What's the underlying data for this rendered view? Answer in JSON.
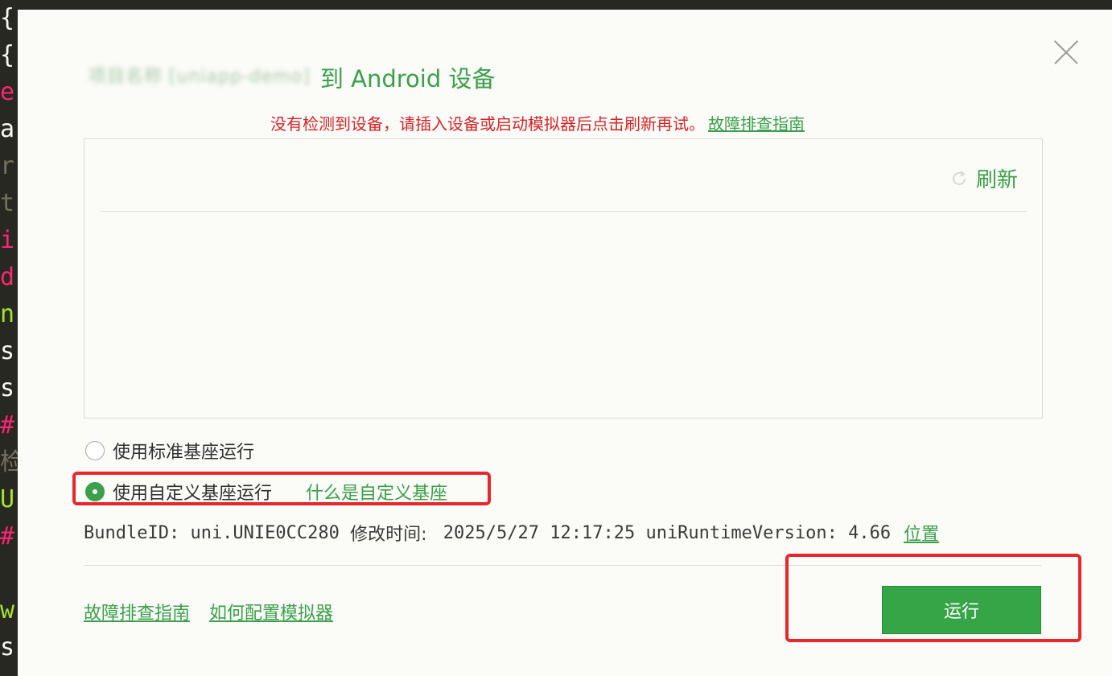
{
  "background_code": {
    "chars": [
      "{",
      "{",
      "e",
      "a",
      "r",
      "t",
      "i",
      "d",
      "n",
      "s",
      "s",
      "#",
      "检",
      "U",
      "#",
      "",
      "w",
      "s"
    ],
    "colors": [
      "#f8f8f2",
      "#f8f8f2",
      "#f92672",
      "#f8f8f2",
      "#75715e",
      "#75715e",
      "#f92672",
      "#f92672",
      "#a6e22e",
      "#f8f8f2",
      "#f8f8f2",
      "#f92672",
      "#75715e",
      "#a6e22e",
      "#f92672",
      "#f8f8f2",
      "#a6e22e",
      "#f8f8f2"
    ]
  },
  "dialog": {
    "title": {
      "project_name_blurred": "项目名称 [uniapp-demo]",
      "text": "到 Android 设备"
    },
    "notice": {
      "text": "没有检测到设备，请插入设备或启动模拟器后点击刷新再试。",
      "link": "故障排查指南"
    },
    "device_panel": {
      "refresh_label": "刷新",
      "refresh_icon": "refresh-icon"
    },
    "options": {
      "standard": {
        "label": "使用标准基座运行",
        "selected": false
      },
      "custom": {
        "label": "使用自定义基座运行",
        "selected": true,
        "help_link": "什么是自定义基座"
      }
    },
    "info": {
      "bundle_label": "BundleID: uni.UNIE0CC280 ",
      "modified_label": "修改时间: ",
      "modified_value": " 2025/5/27 12:17:25 uniRuntimeVersion: 4.66",
      "location_link": "位置"
    },
    "footer": {
      "links": [
        "故障排查指南",
        "如何配置模拟器"
      ],
      "run_button": "运行"
    }
  },
  "colors": {
    "accent": "#3aa04b",
    "error": "#d6242a",
    "highlight_box": "#e8262e",
    "run_button": "#35a547"
  }
}
